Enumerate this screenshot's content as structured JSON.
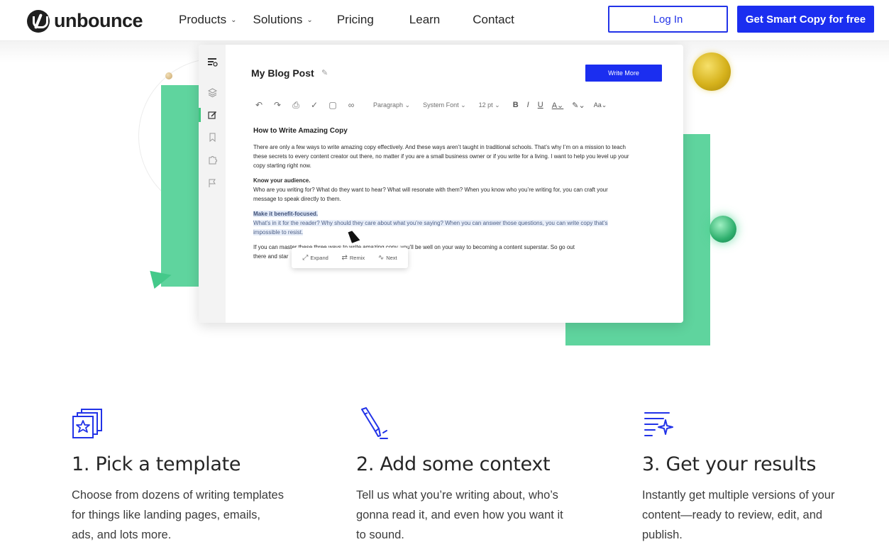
{
  "nav": {
    "logo_text": "unbounce",
    "links": [
      {
        "label": "Products",
        "has_dropdown": true
      },
      {
        "label": "Solutions",
        "has_dropdown": true
      },
      {
        "label": "Pricing",
        "has_dropdown": false
      },
      {
        "label": "Learn",
        "has_dropdown": false
      },
      {
        "label": "Contact",
        "has_dropdown": false
      }
    ],
    "login_label": "Log In",
    "cta_label": "Get Smart Copy for free",
    "accent_color": "#1b2ef0"
  },
  "editor": {
    "doc_title": "My Blog Post",
    "write_more_label": "Write More",
    "toolbar": {
      "block_style": "Paragraph",
      "font": "System Font",
      "size": "12 pt",
      "bold": "B",
      "italic": "I",
      "underline": "U",
      "color": "A",
      "case": "Aa"
    },
    "body": {
      "heading": "How to Write Amazing Copy",
      "intro": "There are only a few ways to write amazing copy effectively. And these ways aren’t taught in traditional schools. That’s why I’m on a mission to teach these secrets to every content creator out there, no matter if you are a small business owner or if you write for a living. I want to help you level up your copy starting right now.",
      "s1_title": "Know your audience.",
      "s1_text": "Who are you writing for? What do they want to hear? What will resonate with them? When you know who you’re writing for, you can craft your message to speak directly to them.",
      "s2_title": "Make it benefit-focused.",
      "s2_text": "What’s in it for the reader? Why should they care about what you’re saying? When you can answer those questions, you can write copy that’s impossible to resist.",
      "outro_a": "If you can master these three ways to write amazing copy, you’ll be well on your way to becoming a content superstar. So go out",
      "outro_b": "there and star"
    },
    "popup": {
      "expand": "Expand",
      "remix": "Remix",
      "next": "Next"
    },
    "sidebar_icons": [
      "dashboard-icon",
      "layers-icon",
      "edit-icon",
      "bookmark-icon",
      "puzzle-icon",
      "flag-icon"
    ]
  },
  "decor": {
    "green": "#5fd49e",
    "gold": "#e3c23a"
  },
  "steps": [
    {
      "icon": "template-stack-icon",
      "title": "1. Pick a template",
      "desc": "Choose from dozens of writing templates for things like landing pages, emails, ads, and lots more."
    },
    {
      "icon": "marker-pen-icon",
      "title": "2. Add some context",
      "desc": "Tell us what you’re writing about, who’s gonna read it, and even how you want it to sound."
    },
    {
      "icon": "sparkle-lines-icon",
      "title": "3. Get your results",
      "desc": "Instantly get multiple versions of your content—ready to review, edit, and publish."
    }
  ],
  "icon_color": "#2233e8"
}
